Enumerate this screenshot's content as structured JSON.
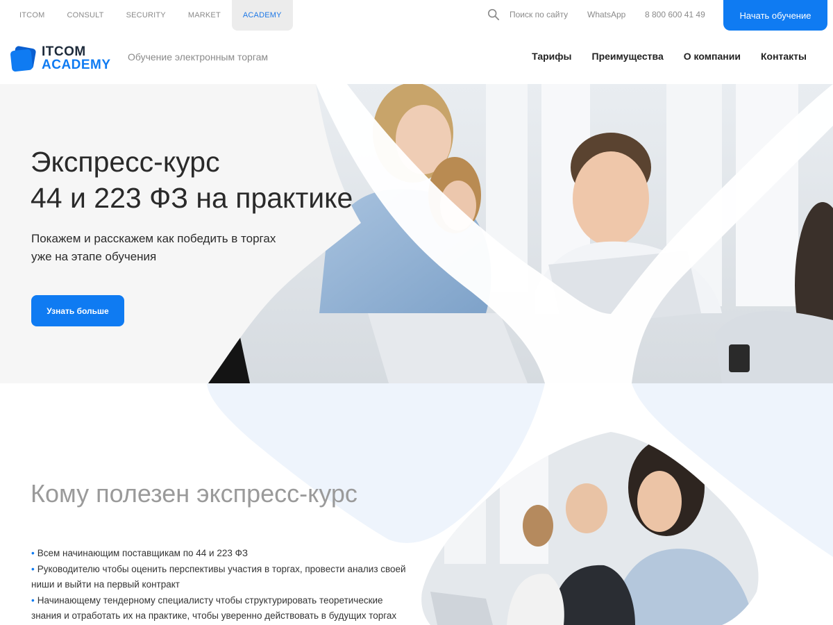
{
  "topnav": {
    "items": [
      "ITCOM",
      "CONSULT",
      "SECURITY",
      "MARKET",
      "ACADEMY"
    ],
    "active": "ACADEMY",
    "search_label": "Поиск по сайту",
    "whatsapp": "WhatsApp",
    "phone": "8 800 600 41 49",
    "cta": "Начать обучение"
  },
  "header": {
    "logo_line1": "ITCOM",
    "logo_line2": "ACADEMY",
    "tagline": "Обучение электронным торгам",
    "nav": [
      "Тарифы",
      "Преимущества",
      "О компании",
      "Контакты"
    ]
  },
  "hero": {
    "title_line1": "Экспресс-курс",
    "title_line2": "44 и 223 ФЗ на практике",
    "subtitle_line1": "Покажем и расскажем как победить в торгах",
    "subtitle_line2": "уже на этапе обучения",
    "button": "Узнать больше"
  },
  "audience": {
    "title": "Кому полезен экспресс-курс",
    "bullets": [
      "Всем начинающим поставщикам по 44 и 223 ФЗ",
      "Руководителю  чтобы оценить перспективы участия в торгах, провести анализ своей ниши и выйти на первый контракт",
      "Начинающему тендерному специалисту чтобы структурировать теоретические знания и отработать их на практике, чтобы уверенно действовать в будущих торгах"
    ]
  },
  "colors": {
    "accent": "#0f7bf2",
    "hero_bg": "#f6f6f6",
    "muted_text": "#8a8a8a",
    "deco_tint": "#eef4fc"
  },
  "icons": {
    "search": "search-icon",
    "logo": "logo-icon"
  }
}
